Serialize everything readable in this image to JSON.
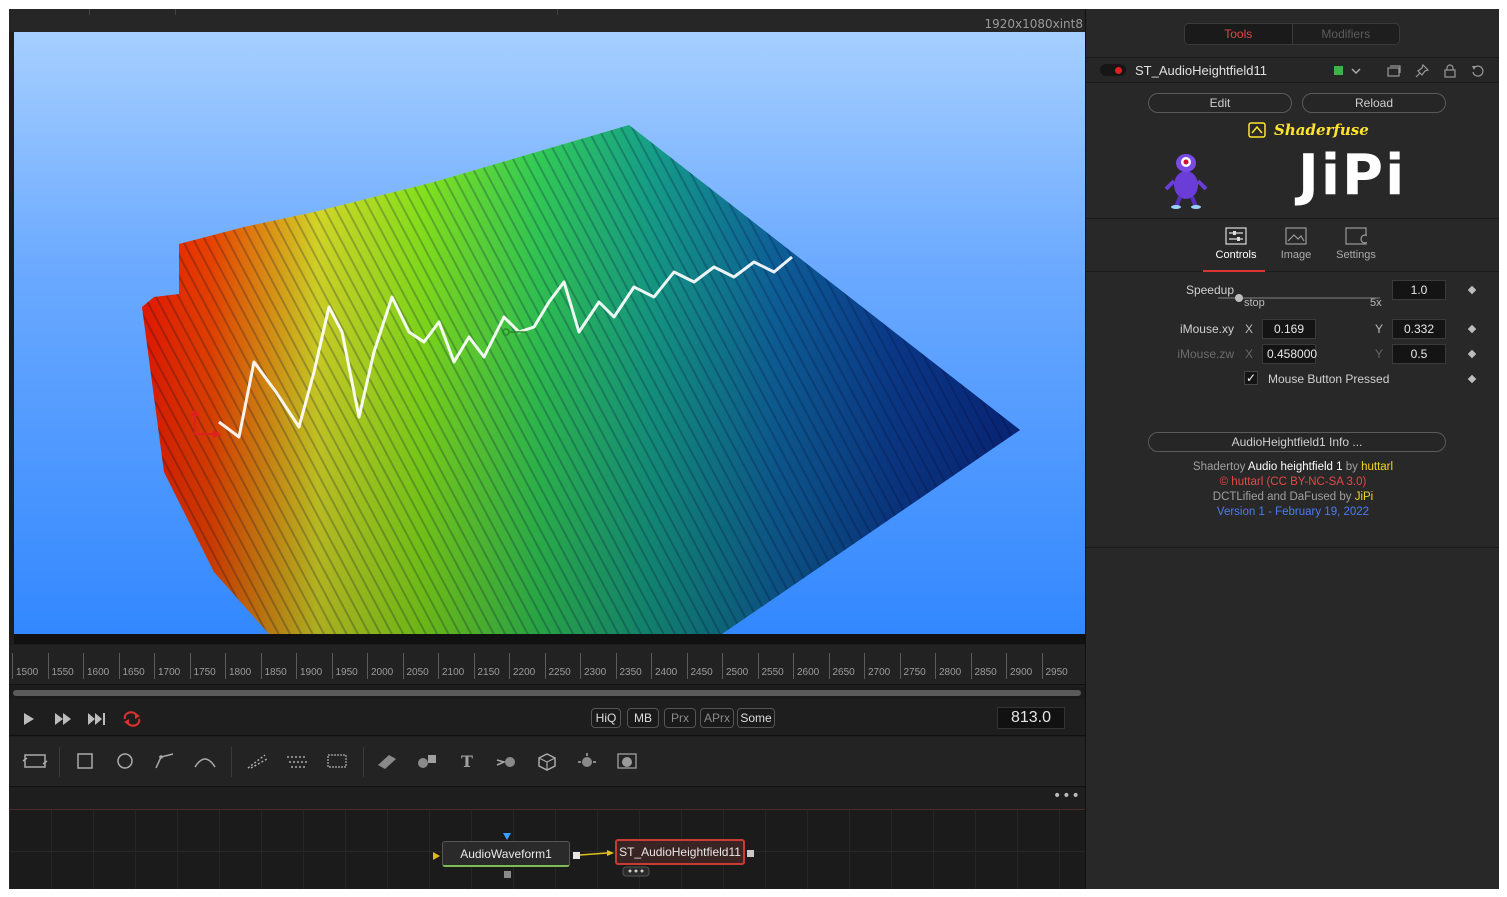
{
  "viewer": {
    "resolution": "1920x1080xint8"
  },
  "ruler": {
    "ticks": [
      "1500",
      "1550",
      "1600",
      "1650",
      "1700",
      "1750",
      "1800",
      "1850",
      "1900",
      "1950",
      "2000",
      "2050",
      "2100",
      "2150",
      "2200",
      "2250",
      "2300",
      "2350",
      "2400",
      "2450",
      "2500",
      "2550",
      "2600",
      "2650",
      "2700",
      "2750",
      "2800",
      "2850",
      "2900",
      "2950"
    ]
  },
  "transport": {
    "play_icon": "play-icon",
    "ff_icon": "fast-forward-icon",
    "end_icon": "skip-to-end-icon",
    "loop_icon": "loop-icon",
    "toggles": {
      "hiq": "HiQ",
      "mb": "MB",
      "prx": "Prx",
      "aprx": "APrx",
      "some": "Some"
    },
    "current_frame": "813.0"
  },
  "node_editor": {
    "more_label": "•••",
    "nodes": {
      "audio": "AudioWaveform1",
      "shader": "ST_AudioHeightfield11"
    }
  },
  "inspector": {
    "tabs": {
      "tools": "Tools",
      "modifiers": "Modifiers"
    },
    "tool_name": "ST_AudioHeightfield11",
    "edit_label": "Edit",
    "reload_label": "Reload",
    "brand": "Shaderfuse",
    "logo": "JiPi",
    "control_tabs": {
      "controls": "Controls",
      "image": "Image",
      "settings": "Settings"
    },
    "params": {
      "speedup_label": "Speedup",
      "speedup_value": "1.0",
      "speedup_min": "stop",
      "speedup_max": "5x",
      "speedup_fraction": 0.13,
      "imouse_xy_label": "iMouse.xy",
      "imouse_x": "0.169",
      "imouse_y": "0.332",
      "imouse_zw_label": "iMouse.zw",
      "imouse_z": "0.458000",
      "imouse_w": "0.5",
      "x_axis": "X",
      "y_axis": "Y",
      "mouse_pressed_label": "Mouse Button Pressed",
      "check_mark": "✓"
    },
    "info_button": "AudioHeightfield1 Info ...",
    "credits": {
      "line1_a": "Shadertoy ",
      "line1_b": "Audio heightfield 1",
      "line1_c": " by ",
      "line1_d": "huttarl",
      "line2": "© huttarl (CC BY-NC-SA 3.0)",
      "line3_a": "DCTLified and DaFused by ",
      "line3_b": "JiPi",
      "line4": "Version 1 - February 19, 2022"
    }
  },
  "colors": {
    "accent_red": "#e04848",
    "brand_yellow": "#ffe52c",
    "node_selected_border": "#c83c32",
    "link_blue": "#4a7cf0"
  }
}
